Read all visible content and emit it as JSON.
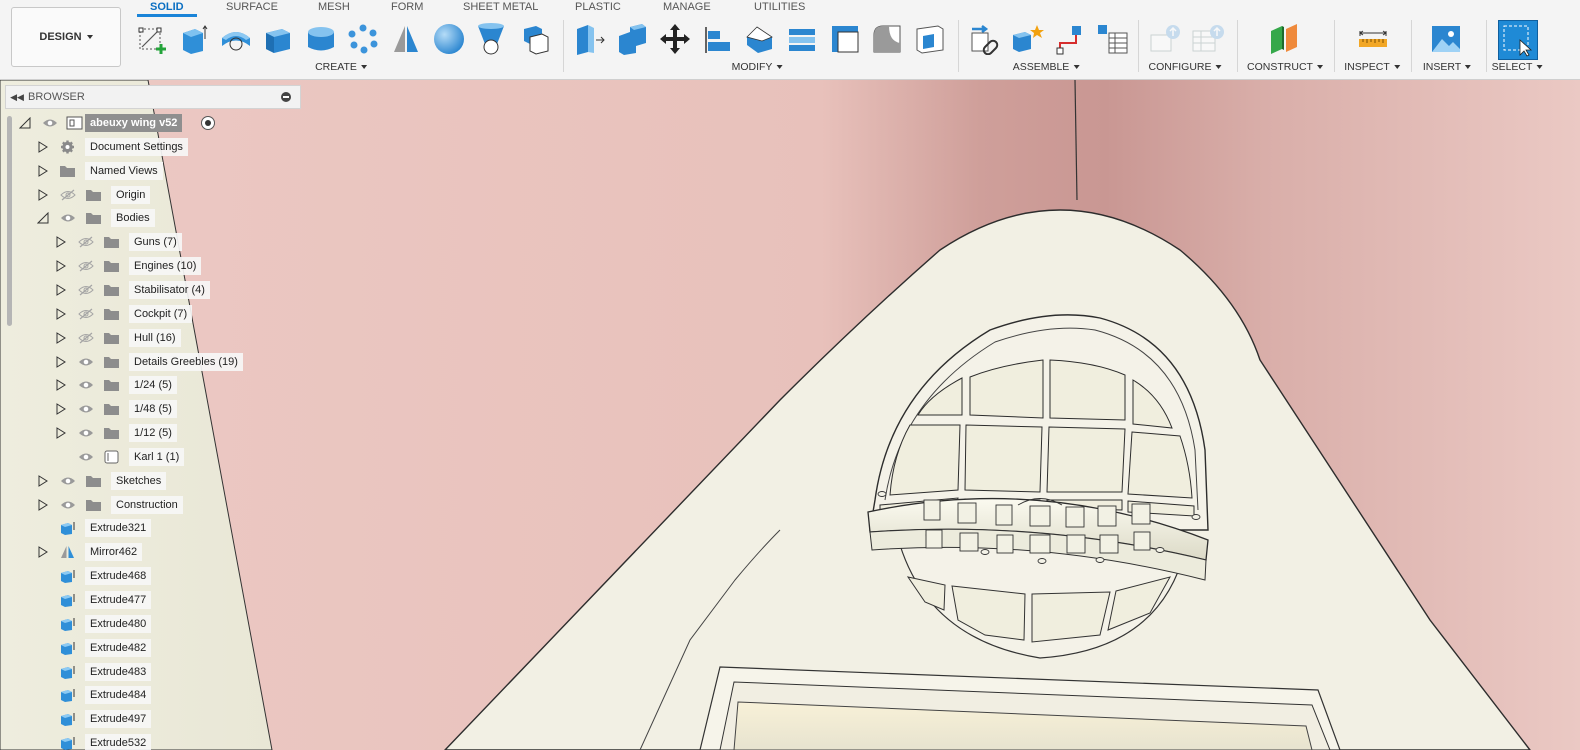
{
  "toolbar": {
    "workspace_label": "DESIGN",
    "tabs": [
      "SOLID",
      "SURFACE",
      "MESH",
      "FORM",
      "SHEET METAL",
      "PLASTIC",
      "MANAGE",
      "UTILITIES"
    ],
    "active_tab": "SOLID",
    "groups": [
      "CREATE",
      "MODIFY",
      "ASSEMBLE",
      "CONFIGURE",
      "CONSTRUCT",
      "INSPECT",
      "INSERT",
      "SELECT"
    ],
    "accent_color": "#1a84d8"
  },
  "browser": {
    "title": "BROWSER",
    "root": "abeuxy wing v52",
    "items": [
      "Document Settings",
      "Named Views",
      "Origin",
      "Bodies",
      "Guns (7)",
      "Engines (10)",
      "Stabilisator (4)",
      "Cockpit (7)",
      "Hull (16)",
      "Details Greebles (19)",
      "1/24 (5)",
      "1/48 (5)",
      "1/12 (5)",
      "Karl 1 (1)",
      "Sketches",
      "Construction",
      "Extrude321",
      "Mirror462",
      "Extrude468",
      "Extrude477",
      "Extrude480",
      "Extrude482",
      "Extrude483",
      "Extrude484",
      "Extrude497",
      "Extrude532"
    ]
  }
}
